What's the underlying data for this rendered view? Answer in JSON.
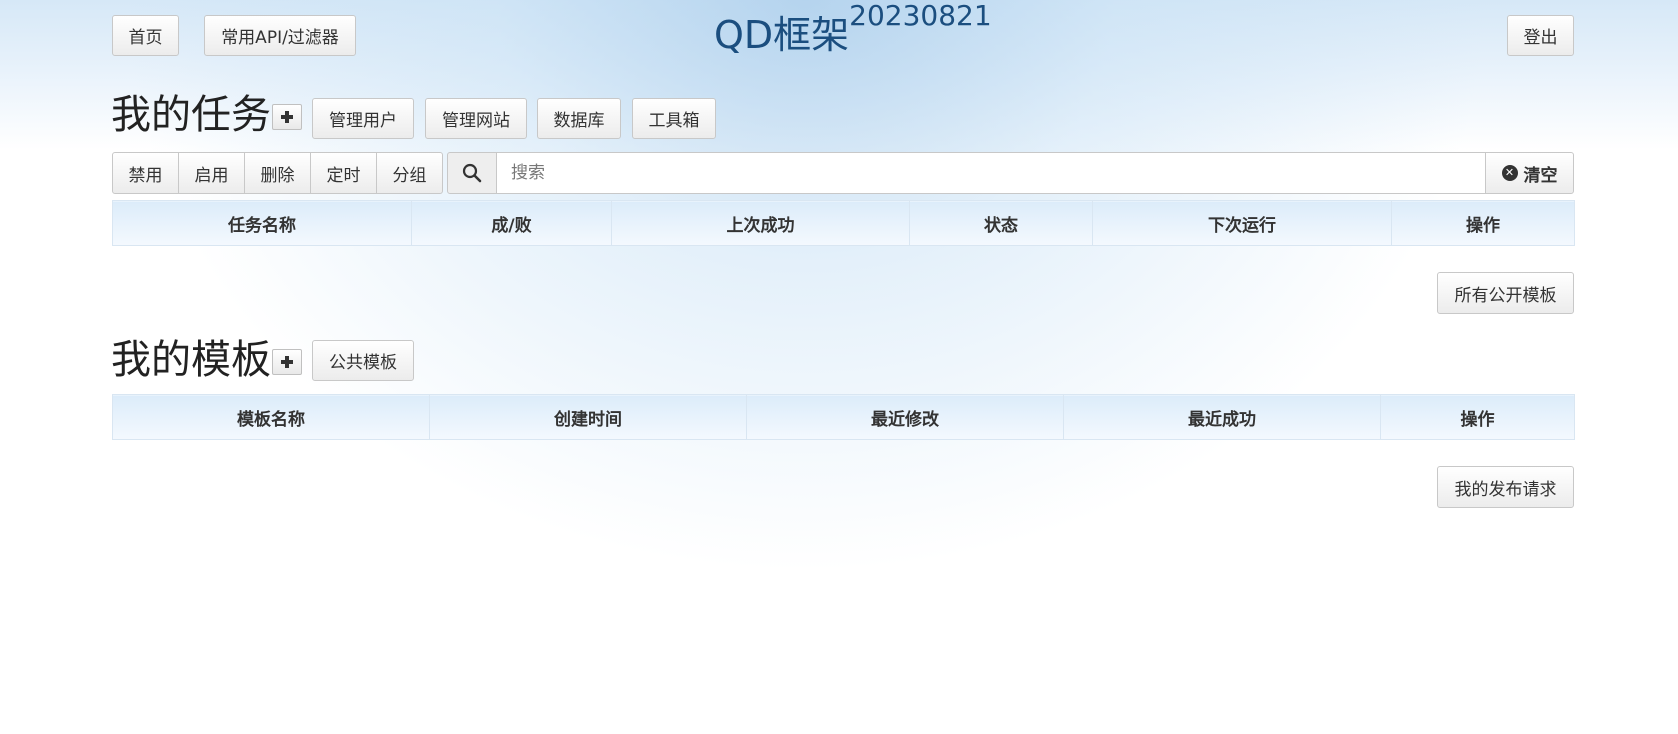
{
  "nav": {
    "home": "首页",
    "api_filter": "常用API/过滤器",
    "title": "QD框架",
    "version": "20230821",
    "logout": "登出"
  },
  "tasks": {
    "heading": "我的任务",
    "add_icon": "plus-icon",
    "manage_users": "管理用户",
    "manage_sites": "管理网站",
    "database": "数据库",
    "toolbox": "工具箱",
    "actions": [
      "禁用",
      "启用",
      "删除",
      "定时",
      "分组"
    ],
    "search_placeholder": "搜索",
    "search_icon": "search-icon",
    "clear_label": "清空",
    "columns": [
      "任务名称",
      "成/败",
      "上次成功",
      "状态",
      "下次运行",
      "操作"
    ],
    "rows": []
  },
  "all_public_templates": "所有公开模板",
  "templates": {
    "heading": "我的模板",
    "add_icon": "plus-icon",
    "public_templates": "公共模板",
    "columns": [
      "模板名称",
      "创建时间",
      "最近修改",
      "最近成功",
      "操作"
    ],
    "rows": []
  },
  "my_publish_requests": "我的发布请求",
  "colors": {
    "title": "#1b4e7f",
    "header_gradient_top": "#dcecfa",
    "header_gradient_bottom": "#f4f9fe"
  }
}
